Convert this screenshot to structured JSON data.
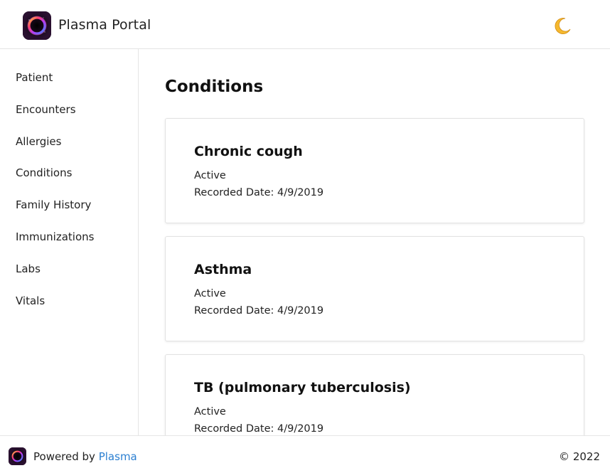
{
  "header": {
    "logo_icon": "plasma-ring-logo",
    "title": "Plasma Portal",
    "theme_toggle_icon": "crescent-moon-icon"
  },
  "sidebar": {
    "items": [
      {
        "label": "Patient"
      },
      {
        "label": "Encounters"
      },
      {
        "label": "Allergies"
      },
      {
        "label": "Conditions"
      },
      {
        "label": "Family History"
      },
      {
        "label": "Immunizations"
      },
      {
        "label": "Labs"
      },
      {
        "label": "Vitals"
      }
    ]
  },
  "main": {
    "title": "Conditions",
    "conditions": [
      {
        "name": "Chronic cough",
        "status": "Active",
        "recorded": "Recorded Date: 4/9/2019"
      },
      {
        "name": "Asthma",
        "status": "Active",
        "recorded": "Recorded Date: 4/9/2019"
      },
      {
        "name": "TB (pulmonary tuberculosis)",
        "status": "Active",
        "recorded": "Recorded Date: 4/9/2019"
      }
    ]
  },
  "footer": {
    "powered_prefix": "Powered by ",
    "powered_link": "Plasma",
    "copyright": "© 2022",
    "link_color": "#2b7fd1"
  }
}
